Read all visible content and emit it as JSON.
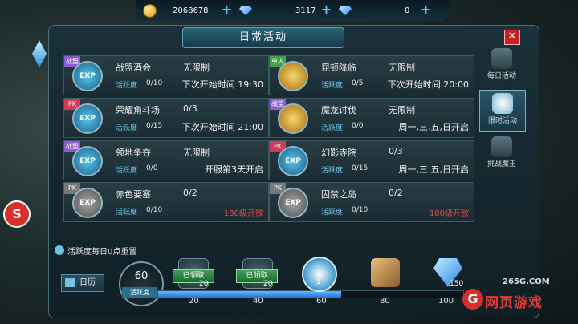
{
  "currency": [
    {
      "icon": "gold-coin-icon",
      "value": "2068678"
    },
    {
      "icon": "blue-diamond-icon",
      "value": "3117"
    },
    {
      "icon": "bound-diamond-icon",
      "value": "0"
    }
  ],
  "panel": {
    "title": "日常活动",
    "close": "✕"
  },
  "activity_label": "活跃度",
  "activities": [
    {
      "badge": "战盟",
      "badge_color": "#8b5bd0",
      "icon": "exp-icon",
      "name": "战盟酒会",
      "limit": "无限制",
      "activity": "0/10",
      "time": "下次开始时间 19:30",
      "red": false
    },
    {
      "badge": "单人",
      "badge_color": "#43a04a",
      "icon": "gold-medal-icon",
      "name": "昆顿降临",
      "limit": "无限制",
      "activity": "0/5",
      "time": "下次开始时间 20:00",
      "red": false
    },
    {
      "badge": "PK",
      "badge_color": "#d03b59",
      "icon": "exp-icon",
      "name": "荣耀角斗场",
      "limit": "0/3",
      "activity": "0/15",
      "time": "下次开始时间 21:00",
      "red": false
    },
    {
      "badge": "战盟",
      "badge_color": "#8b5bd0",
      "icon": "gold-medal-icon",
      "name": "魔龙讨伐",
      "limit": "无限制",
      "activity": "0/0",
      "time": "周一,三,五,日开启",
      "red": false
    },
    {
      "badge": "战盟",
      "badge_color": "#8b5bd0",
      "icon": "exp-icon",
      "name": "领地争夺",
      "limit": "无限制",
      "activity": "0/0",
      "time": "开服第3天开启",
      "red": false
    },
    {
      "badge": "PK",
      "badge_color": "#d03b59",
      "icon": "exp-icon",
      "name": "幻影寺院",
      "limit": "0/3",
      "activity": "0/15",
      "time": "周一,三,五,日开启",
      "red": false
    },
    {
      "badge": "PK",
      "badge_color": "#777777",
      "icon": "exp-grey-icon",
      "name": "赤色要塞",
      "limit": "0/2",
      "activity": "0/10",
      "time": "180级开放",
      "red": true
    },
    {
      "badge": "PK",
      "badge_color": "#777777",
      "icon": "exp-grey-icon",
      "name": "囚禁之岛",
      "limit": "0/2",
      "activity": "0/10",
      "time": "180级开放",
      "red": true
    }
  ],
  "exp_text": "EXP",
  "tabs": [
    {
      "label": "每日活动",
      "active": false
    },
    {
      "label": "限时活动",
      "active": true
    },
    {
      "label": "挑战魔王",
      "active": false
    }
  ],
  "reset_note": "活跃度每日0点重置",
  "calendar_label": "日历",
  "activity_points": {
    "value": "60",
    "label": "活跃度"
  },
  "progress": {
    "fraction": 0.6
  },
  "milestones": [
    {
      "value": "20",
      "reward": "chest-icon",
      "status": "已领取",
      "count": "20"
    },
    {
      "value": "40",
      "reward": "chest-icon",
      "status": "已领取",
      "count": "20"
    },
    {
      "value": "60",
      "reward": "star-emblem-icon",
      "status": "",
      "count": "1"
    },
    {
      "value": "80",
      "reward": "scroll-icon",
      "status": "",
      "count": ""
    },
    {
      "value": "100",
      "reward": "diamond-icon",
      "status": "",
      "count": "150"
    }
  ],
  "watermark": {
    "url": "265G.COM",
    "text": "网页游戏",
    "logo": "G"
  }
}
